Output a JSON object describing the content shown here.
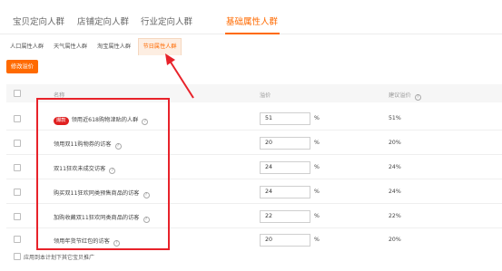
{
  "top_tabs": [
    {
      "label": "宝贝定向人群"
    },
    {
      "label": "店铺定向人群"
    },
    {
      "label": "行业定向人群"
    },
    {
      "label": "基础属性人群"
    }
  ],
  "sub_tabs": [
    {
      "label": "人口属性人群"
    },
    {
      "label": "天气属性人群"
    },
    {
      "label": "淘宝属性人群"
    },
    {
      "label": "节日属性人群"
    }
  ],
  "modify_button": "修改溢价",
  "table": {
    "headers": {
      "name": "名称",
      "premium": "溢价",
      "suggested": "建议溢价"
    },
    "rows": [
      {
        "badge": "爆款",
        "name": "领用近618购物津贴的人群",
        "value": "51",
        "unit": "%",
        "suggested": "51%"
      },
      {
        "badge": "",
        "name": "领用双11购物券的访客",
        "value": "20",
        "unit": "%",
        "suggested": "20%"
      },
      {
        "badge": "",
        "name": "双11狂欢未成交访客",
        "value": "24",
        "unit": "%",
        "suggested": "24%"
      },
      {
        "badge": "",
        "name": "购买双11狂欢同类预售商品的访客",
        "value": "24",
        "unit": "%",
        "suggested": "24%"
      },
      {
        "badge": "",
        "name": "加购收藏双11狂欢同类商品的访客",
        "value": "22",
        "unit": "%",
        "suggested": "22%"
      },
      {
        "badge": "",
        "name": "领用年货节红包的访客",
        "value": "20",
        "unit": "%",
        "suggested": "20%"
      }
    ]
  },
  "apply_label": "应用到本计划下其它宝贝推广",
  "colors": {
    "accent": "#ff6a00",
    "highlight": "#e8222a"
  },
  "icons": {
    "help": "question-circle-icon"
  }
}
